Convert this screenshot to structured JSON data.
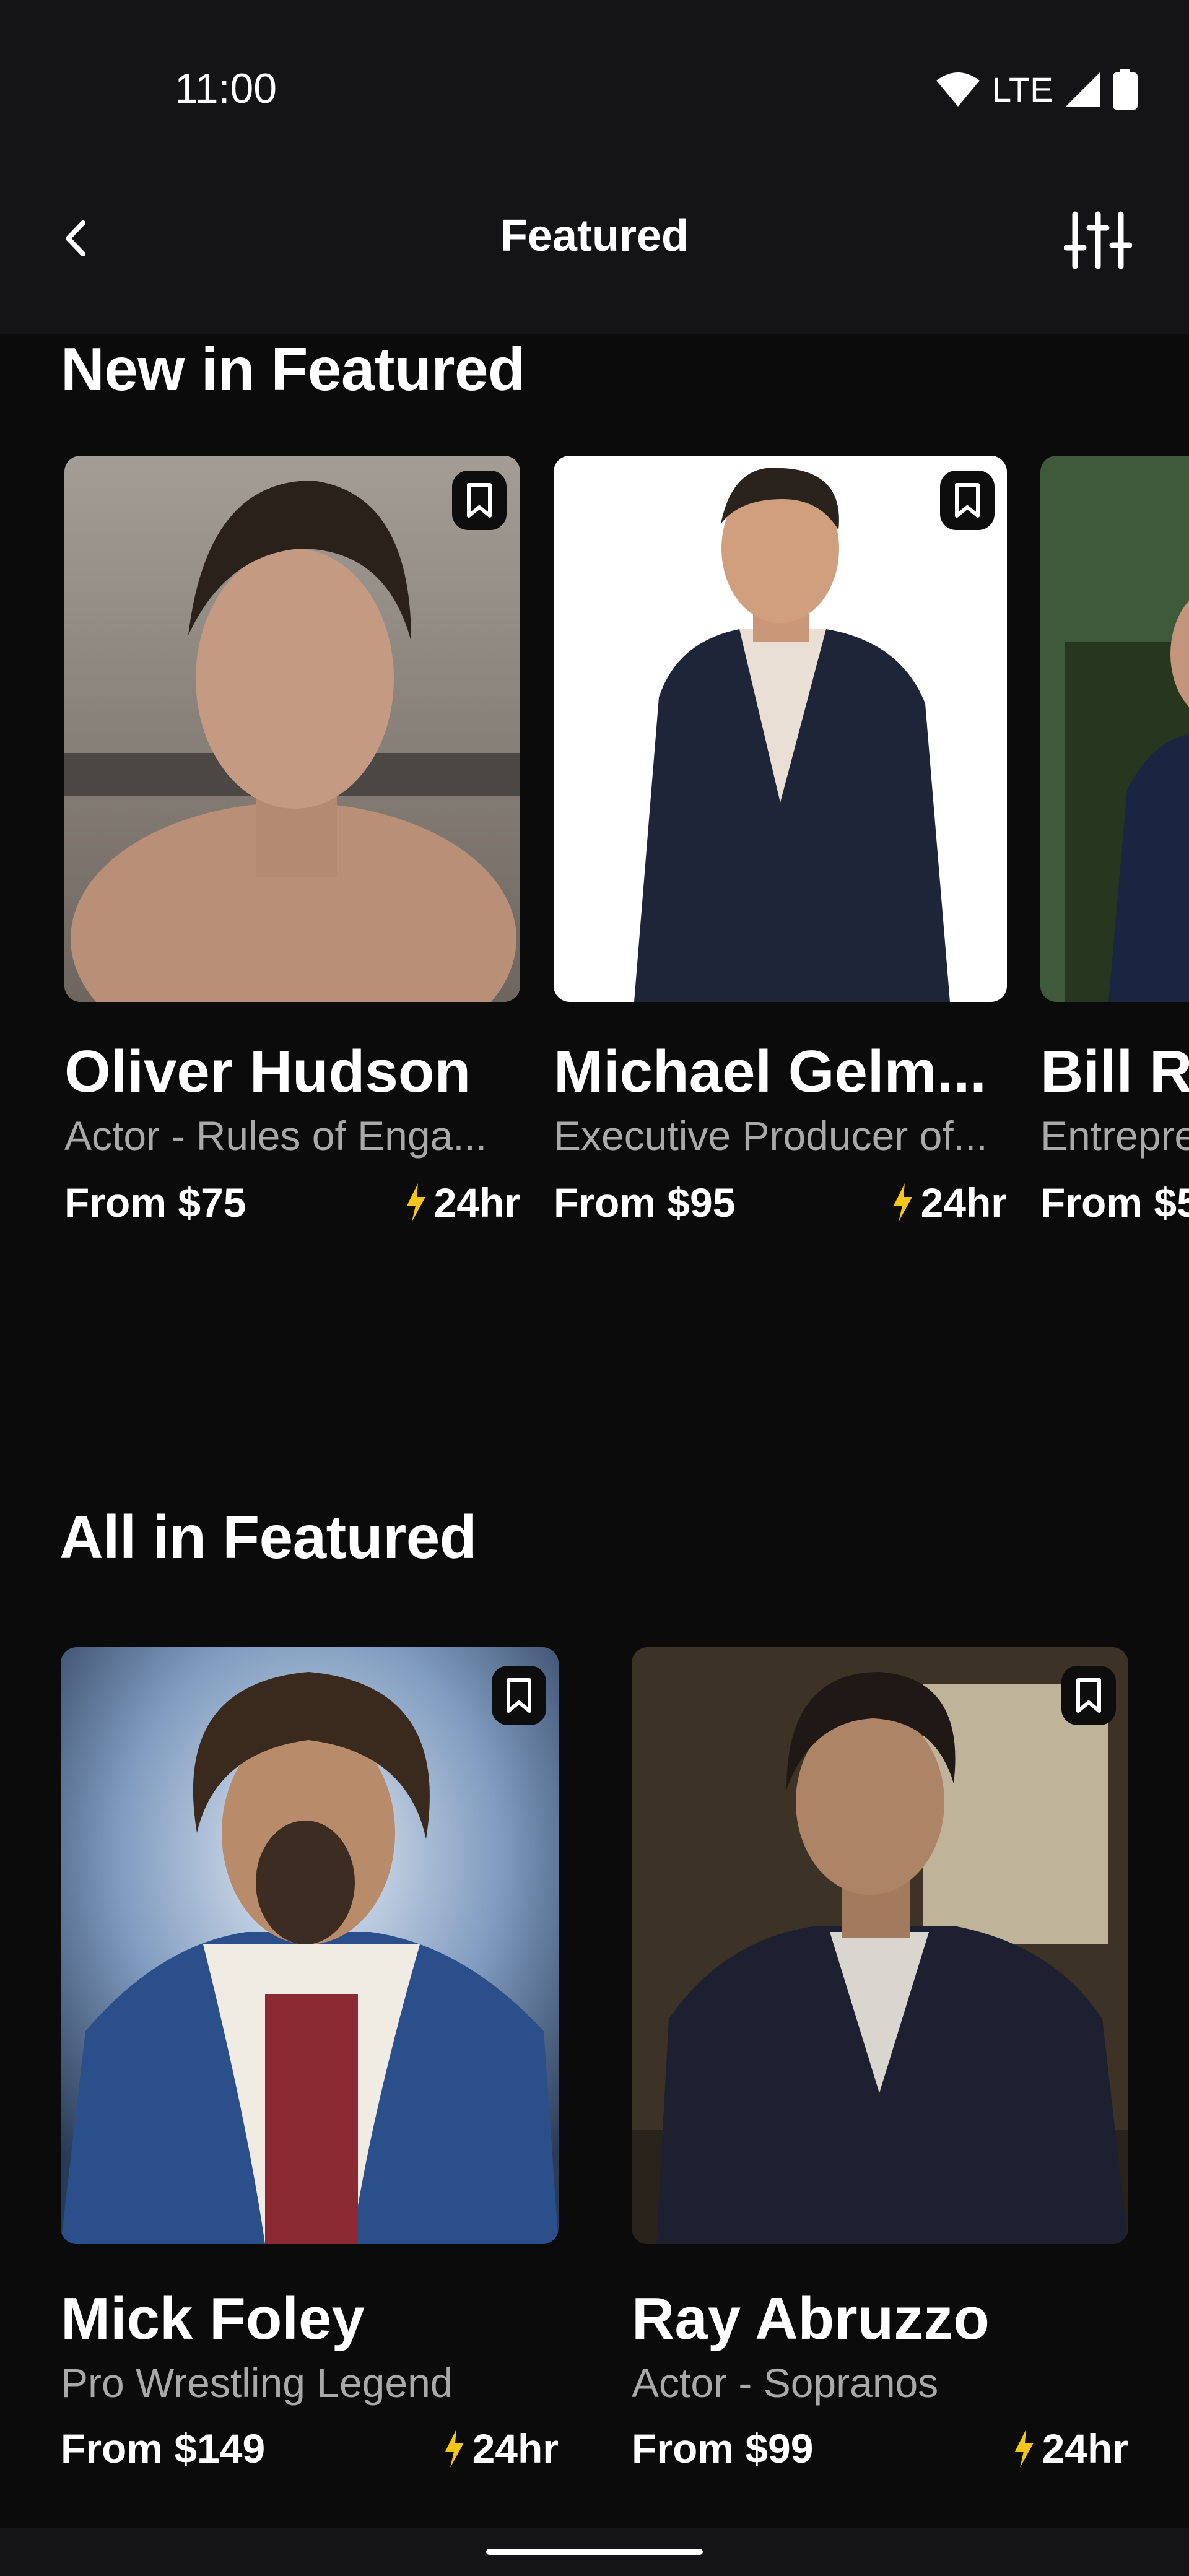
{
  "status": {
    "time": "11:00",
    "network": "LTE"
  },
  "header": {
    "title": "Featured",
    "back_icon": "chevron-left-icon",
    "filter_icon": "sliders-icon"
  },
  "new_section": {
    "title": "New in Featured",
    "cards": [
      {
        "name": "Oliver Hudson",
        "subtitle": "Actor - Rules of Enga...",
        "price": "From $75",
        "turnaround": "24hr"
      },
      {
        "name": "Michael Gelm...",
        "subtitle": "Executive Producer of...",
        "price": "From $95",
        "turnaround": "24hr"
      },
      {
        "name": "Bill Ra",
        "subtitle": "Entrepre",
        "price": "From $5"
      }
    ]
  },
  "all_section": {
    "title": "All in Featured",
    "cards": [
      {
        "name": "Mick Foley",
        "subtitle": "Pro Wrestling Legend",
        "price": "From $149",
        "turnaround": "24hr"
      },
      {
        "name": "Ray Abruzzo",
        "subtitle": "Actor - Sopranos",
        "price": "From $99",
        "turnaround": "24hr"
      }
    ]
  },
  "colors": {
    "background": "#0b0b0c",
    "bar": "#141416",
    "accent_bolt": "#f5c518",
    "subtitle": "#a9a9a9"
  }
}
